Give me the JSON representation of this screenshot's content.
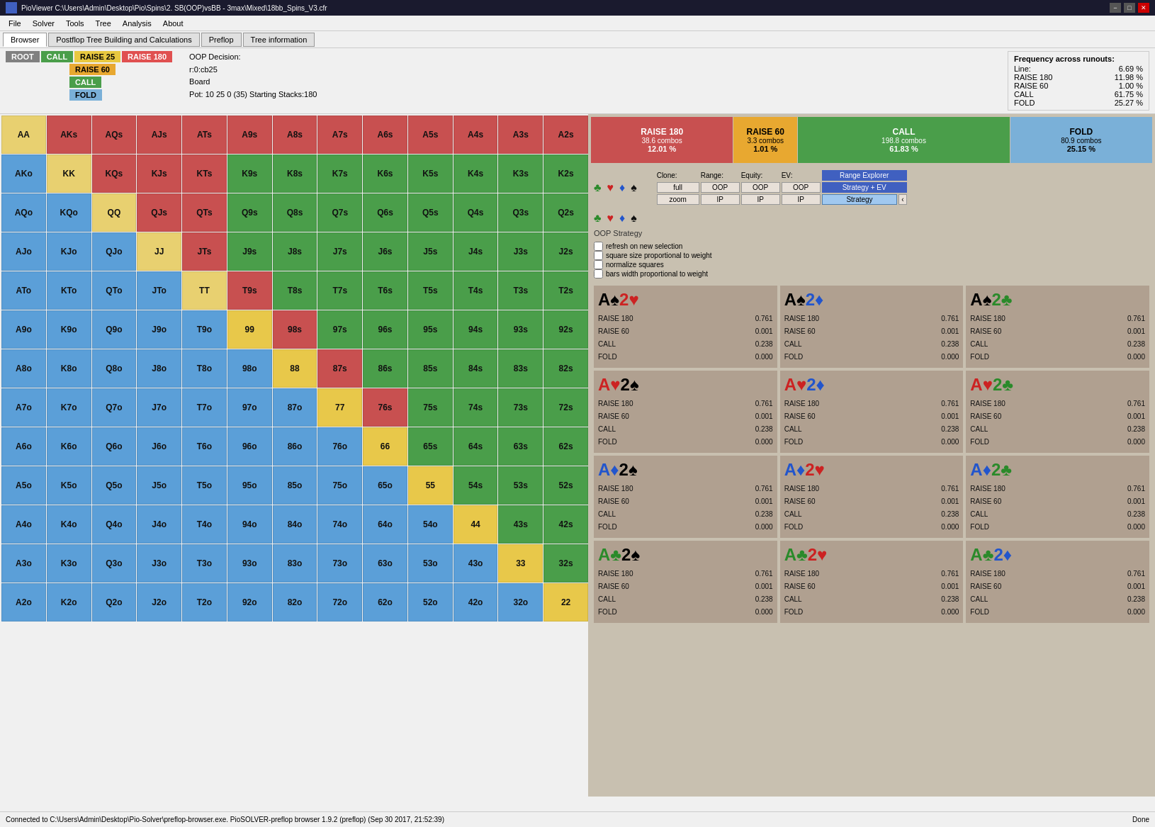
{
  "titlebar": {
    "title": "PioViewer C:\\Users\\Admin\\Desktop\\Pio\\Spins\\2. SB(OOP)vsBB - 3max\\Mixed\\18bb_Spins_V3.cfr",
    "min": "−",
    "max": "□",
    "close": "✕"
  },
  "menubar": {
    "items": [
      "File",
      "Solver",
      "Tools",
      "Tree",
      "Analysis",
      "About"
    ]
  },
  "toolbar": {
    "tabs": [
      "Browser",
      "Postflop Tree Building and Calculations",
      "Preflop",
      "Tree information"
    ]
  },
  "action_buttons": {
    "root": "ROOT",
    "call": "CALL",
    "raise25": "RAISE 25",
    "raise180": "RAISE 180",
    "raise60": "RAISE 60",
    "call2": "CALL",
    "fold": "FOLD"
  },
  "info": {
    "oop_decision": "OOP Decision:",
    "line": "r:0:cb25",
    "board": "Board",
    "pot": "Pot: 10 25 0 (35) Starting Stacks:180"
  },
  "freq_panel": {
    "title": "Frequency across runouts:",
    "line_label": "Line:",
    "line_value": "6.69 %",
    "rows": [
      {
        "label": "RAISE 180",
        "value": "11.98 %"
      },
      {
        "label": "RAISE 60",
        "value": "1.00 %"
      },
      {
        "label": "CALL",
        "value": "61.75 %"
      },
      {
        "label": "FOLD",
        "value": "25.27 %"
      }
    ]
  },
  "action_summary": [
    {
      "id": "raise180",
      "label": "RAISE 180",
      "combos": "38.6 combos",
      "pct": "12.01 %"
    },
    {
      "id": "raise60",
      "label": "RAISE 60",
      "combos": "3.3 combos",
      "pct": "1.01 %"
    },
    {
      "id": "call",
      "label": "CALL",
      "combos": "198.8 combos",
      "pct": "61.83 %"
    },
    {
      "id": "fold",
      "label": "FOLD",
      "combos": "80.9 combos",
      "pct": "25.15 %"
    }
  ],
  "suits": {
    "row1": [
      "♣",
      "♥",
      "♦",
      "♠"
    ],
    "row2": [
      "♣",
      "♥",
      "♦",
      "♠"
    ]
  },
  "controls": {
    "clone_label": "Clone:",
    "range_label": "Range:",
    "equity_label": "Equity:",
    "ev_label": "EV:",
    "full": "full",
    "oop": "OOP",
    "zoom": "zoom",
    "ip": "IP",
    "range_explorer": "Range Explorer",
    "strategy_ev": "Strategy + EV",
    "strategy": "Strategy",
    "arrow": "‹"
  },
  "oop_strategy": "OOP Strategy",
  "checkboxes": [
    "refresh on new selection",
    "square size proportional to weight",
    "normalize squares",
    "bars width proportional to weight"
  ],
  "combos": [
    {
      "rank1": "A",
      "suit1": "♠",
      "rank2": "2",
      "suit2": "♥",
      "suit1color": "black",
      "suit2color": "#cc2222",
      "raise180": "0.761",
      "raise60": "0.001",
      "call": "0.238",
      "fold": "0.000"
    },
    {
      "rank1": "A",
      "suit1": "♠",
      "rank2": "2",
      "suit2": "♦",
      "suit1color": "black",
      "suit2color": "#2255cc",
      "raise180": "0.761",
      "raise60": "0.001",
      "call": "0.238",
      "fold": "0.000"
    },
    {
      "rank1": "A",
      "suit1": "♠",
      "rank2": "2",
      "suit2": "♣",
      "suit1color": "black",
      "suit2color": "#2a8a2a",
      "raise180": "0.761",
      "raise60": "0.001",
      "call": "0.238",
      "fold": "0.000"
    },
    {
      "rank1": "A",
      "suit1": "♥",
      "rank2": "2",
      "suit2": "♠",
      "suit1color": "#cc2222",
      "suit2color": "black",
      "raise180": "0.761",
      "raise60": "0.001",
      "call": "0.238",
      "fold": "0.000"
    },
    {
      "rank1": "A",
      "suit1": "♥",
      "rank2": "2",
      "suit2": "♦",
      "suit1color": "#cc2222",
      "suit2color": "#2255cc",
      "raise180": "0.761",
      "raise60": "0.001",
      "call": "0.238",
      "fold": "0.000"
    },
    {
      "rank1": "A",
      "suit1": "♥",
      "rank2": "2",
      "suit2": "♣",
      "suit1color": "#cc2222",
      "suit2color": "#2a8a2a",
      "raise180": "0.761",
      "raise60": "0.001",
      "call": "0.238",
      "fold": "0.000"
    },
    {
      "rank1": "A",
      "suit1": "♦",
      "rank2": "2",
      "suit2": "♠",
      "suit1color": "#2255cc",
      "suit2color": "black",
      "raise180": "0.761",
      "raise60": "0.001",
      "call": "0.238",
      "fold": "0.000"
    },
    {
      "rank1": "A",
      "suit1": "♦",
      "rank2": "2",
      "suit2": "♥",
      "suit1color": "#2255cc",
      "suit2color": "#cc2222",
      "raise180": "0.761",
      "raise60": "0.001",
      "call": "0.238",
      "fold": "0.000"
    },
    {
      "rank1": "A",
      "suit1": "♦",
      "rank2": "2",
      "suit2": "♣",
      "suit1color": "#2255cc",
      "suit2color": "#2a8a2a",
      "raise180": "0.761",
      "raise60": "0.001",
      "call": "0.238",
      "fold": "0.000"
    },
    {
      "rank1": "A",
      "suit1": "♣",
      "rank2": "2",
      "suit2": "♠",
      "suit1color": "#2a8a2a",
      "suit2color": "black",
      "raise180": "0.761",
      "raise60": "0.001",
      "call": "0.238",
      "fold": "0.000"
    },
    {
      "rank1": "A",
      "suit1": "♣",
      "rank2": "2",
      "suit2": "♥",
      "suit1color": "#2a8a2a",
      "suit2color": "#cc2222",
      "raise180": "0.761",
      "raise60": "0.001",
      "call": "0.238",
      "fold": "0.000"
    },
    {
      "rank1": "A",
      "suit1": "♣",
      "rank2": "2",
      "suit2": "♦",
      "suit1color": "#2a8a2a",
      "suit2color": "#2255cc",
      "raise180": "0.761",
      "raise60": "0.001",
      "call": "0.238",
      "fold": "0.000"
    }
  ],
  "matrix": [
    [
      "AA",
      "AKs",
      "AQs",
      "AJs",
      "ATs",
      "A9s",
      "A8s",
      "A7s",
      "A6s",
      "A5s",
      "A4s",
      "A3s",
      "A2s"
    ],
    [
      "AKo",
      "KK",
      "KQs",
      "KJs",
      "KTs",
      "K9s",
      "K8s",
      "K7s",
      "K6s",
      "K5s",
      "K4s",
      "K3s",
      "K2s"
    ],
    [
      "AQo",
      "KQo",
      "QQ",
      "QJs",
      "QTs",
      "Q9s",
      "Q8s",
      "Q7s",
      "Q6s",
      "Q5s",
      "Q4s",
      "Q3s",
      "Q2s"
    ],
    [
      "AJo",
      "KJo",
      "QJo",
      "JJ",
      "JTs",
      "J9s",
      "J8s",
      "J7s",
      "J6s",
      "J5s",
      "J4s",
      "J3s",
      "J2s"
    ],
    [
      "ATo",
      "KTo",
      "QTo",
      "JTo",
      "TT",
      "T9s",
      "T8s",
      "T7s",
      "T6s",
      "T5s",
      "T4s",
      "T3s",
      "T2s"
    ],
    [
      "A9o",
      "K9o",
      "Q9o",
      "J9o",
      "T9o",
      "99",
      "98s",
      "97s",
      "96s",
      "95s",
      "94s",
      "93s",
      "92s"
    ],
    [
      "A8o",
      "K8o",
      "Q8o",
      "J8o",
      "T8o",
      "98o",
      "88",
      "87s",
      "86s",
      "85s",
      "84s",
      "83s",
      "82s"
    ],
    [
      "A7o",
      "K7o",
      "Q7o",
      "J7o",
      "T7o",
      "97o",
      "87o",
      "77",
      "76s",
      "75s",
      "74s",
      "73s",
      "72s"
    ],
    [
      "A6o",
      "K6o",
      "Q6o",
      "J6o",
      "T6o",
      "96o",
      "86o",
      "76o",
      "66",
      "65s",
      "64s",
      "63s",
      "62s"
    ],
    [
      "A5o",
      "K5o",
      "Q5o",
      "J5o",
      "T5o",
      "95o",
      "85o",
      "75o",
      "65o",
      "55",
      "54s",
      "53s",
      "52s"
    ],
    [
      "A4o",
      "K4o",
      "Q4o",
      "J4o",
      "T4o",
      "94o",
      "84o",
      "74o",
      "64o",
      "54o",
      "44",
      "43s",
      "42s"
    ],
    [
      "A3o",
      "K3o",
      "Q3o",
      "J3o",
      "T3o",
      "93o",
      "83o",
      "73o",
      "63o",
      "53o",
      "43o",
      "33",
      "32s"
    ],
    [
      "A2o",
      "K2o",
      "Q2o",
      "J2o",
      "T2o",
      "92o",
      "82o",
      "72o",
      "62o",
      "52o",
      "42o",
      "32o",
      "22"
    ]
  ],
  "cell_colors": [
    [
      "pair",
      "suited",
      "suited",
      "suited",
      "suited",
      "suited",
      "suited",
      "suited",
      "suited",
      "suited",
      "suited",
      "suited",
      "suited"
    ],
    [
      "offsuit",
      "pair",
      "suited",
      "suited",
      "suited",
      "suited",
      "suited",
      "suited",
      "suited",
      "suited",
      "suited",
      "suited",
      "suited"
    ],
    [
      "offsuit",
      "offsuit",
      "pair",
      "suited",
      "suited",
      "suited",
      "suited",
      "suited",
      "suited",
      "suited",
      "suited",
      "suited",
      "suited"
    ],
    [
      "offsuit",
      "offsuit",
      "offsuit",
      "pair",
      "suited",
      "suited",
      "suited",
      "suited",
      "suited",
      "suited",
      "suited",
      "suited",
      "suited"
    ],
    [
      "offsuit",
      "offsuit",
      "offsuit",
      "offsuit",
      "pair",
      "suited",
      "suited",
      "suited",
      "suited",
      "suited",
      "suited",
      "suited",
      "suited"
    ],
    [
      "offsuit",
      "offsuit",
      "offsuit",
      "offsuit",
      "offsuit",
      "pair",
      "suited",
      "suited",
      "suited",
      "suited",
      "suited",
      "suited",
      "suited"
    ],
    [
      "offsuit",
      "offsuit",
      "offsuit",
      "offsuit",
      "offsuit",
      "offsuit",
      "pair",
      "suited",
      "suited",
      "suited",
      "suited",
      "suited",
      "suited"
    ],
    [
      "offsuit",
      "offsuit",
      "offsuit",
      "offsuit",
      "offsuit",
      "offsuit",
      "offsuit",
      "pair",
      "suited",
      "suited",
      "suited",
      "suited",
      "suited"
    ],
    [
      "offsuit",
      "offsuit",
      "offsuit",
      "offsuit",
      "offsuit",
      "offsuit",
      "offsuit",
      "offsuit",
      "pair",
      "suited",
      "suited",
      "suited",
      "suited"
    ],
    [
      "offsuit",
      "offsuit",
      "offsuit",
      "offsuit",
      "offsuit",
      "offsuit",
      "offsuit",
      "offsuit",
      "offsuit",
      "pair",
      "suited",
      "suited",
      "suited"
    ],
    [
      "offsuit",
      "offsuit",
      "offsuit",
      "offsuit",
      "offsuit",
      "offsuit",
      "offsuit",
      "offsuit",
      "offsuit",
      "offsuit",
      "pair",
      "suited",
      "suited"
    ],
    [
      "offsuit",
      "offsuit",
      "offsuit",
      "offsuit",
      "offsuit",
      "offsuit",
      "offsuit",
      "offsuit",
      "offsuit",
      "offsuit",
      "offsuit",
      "pair",
      "suited"
    ],
    [
      "offsuit",
      "offsuit",
      "offsuit",
      "offsuit",
      "offsuit",
      "offsuit",
      "offsuit",
      "offsuit",
      "offsuit",
      "offsuit",
      "offsuit",
      "offsuit",
      "pair"
    ]
  ],
  "statusbar": {
    "left": "Connected to C:\\Users\\Admin\\Desktop\\Pio-Solver\\preflop-browser.exe. PioSOLVER-preflop browser 1.9.2 (preflop) (Sep 30 2017, 21:52:39)",
    "right": "Done"
  }
}
